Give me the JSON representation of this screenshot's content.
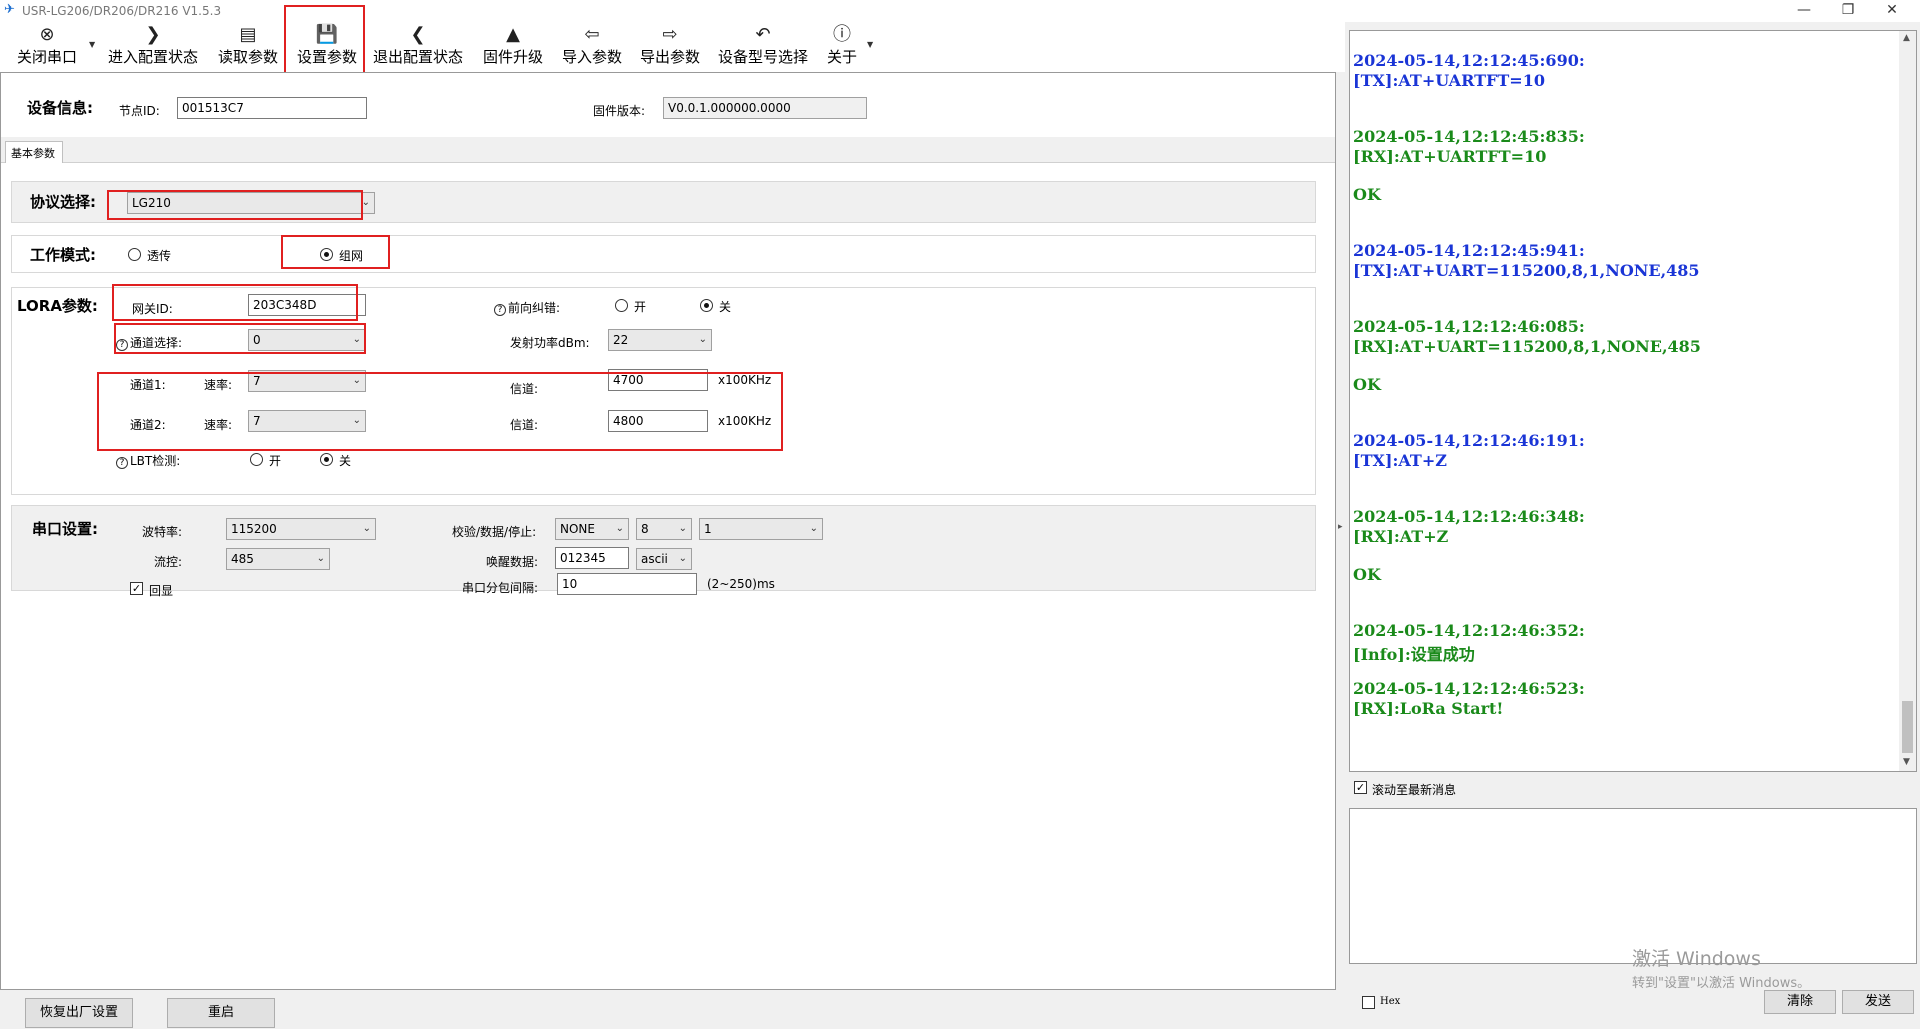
{
  "window": {
    "title": "USR-LG206/DR206/DR216 V1.5.3",
    "minimize": "—",
    "restore": "❐",
    "close": "✕"
  },
  "toolbar": {
    "items": [
      {
        "label": "关闭串口",
        "icon": "⊗"
      },
      {
        "label": "进入配置状态",
        "icon": "❯"
      },
      {
        "label": "读取参数",
        "icon": "▤"
      },
      {
        "label": "设置参数",
        "icon": "💾"
      },
      {
        "label": "退出配置状态",
        "icon": "❮"
      },
      {
        "label": "固件升级",
        "icon": "▲"
      },
      {
        "label": "导入参数",
        "icon": "⇦"
      },
      {
        "label": "导出参数",
        "icon": "⇨"
      },
      {
        "label": "设备型号选择",
        "icon": "↶"
      },
      {
        "label": "关于",
        "icon": "ⓘ"
      }
    ]
  },
  "device_info": {
    "header": "设备信息:",
    "node_id_label": "节点ID:",
    "node_id": "001513C7",
    "fw_label": "固件版本:",
    "fw_version": "V0.0.1.000000.0000"
  },
  "tabs": {
    "basic": "基本参数"
  },
  "protocol": {
    "header": "协议选择:",
    "value": "LG210"
  },
  "work_mode": {
    "header": "工作模式:",
    "opt1": "透传",
    "opt2": "组网",
    "selected": "组网"
  },
  "lora": {
    "header": "LORA参数:",
    "gateway_id_label": "网关ID:",
    "gateway_id": "203C348D",
    "fec_label": "前向纠错:",
    "fec_on": "开",
    "fec_off": "关",
    "channel_select_label": "通道选择:",
    "channel_select": "0",
    "tx_power_label": "发射功率dBm:",
    "tx_power": "22",
    "ch1_label": "通道1:",
    "ch2_label": "通道2:",
    "rate_label": "速率:",
    "ch1_rate": "7",
    "ch2_rate": "7",
    "channel_label": "信道:",
    "ch1_freq": "4700",
    "ch2_freq": "4800",
    "unit": "x100KHz",
    "lbt_label": "LBT检测:",
    "lbt_on": "开",
    "lbt_off": "关"
  },
  "serial": {
    "header": "串口设置:",
    "baud_label": "波特率:",
    "baud": "115200",
    "parity_label": "校验/数据/停止:",
    "parity": "NONE",
    "data_bits": "8",
    "stop_bits": "1",
    "flow_label": "流控:",
    "flow": "485",
    "wake_label": "唤醒数据:",
    "wake_data": "012345",
    "wake_fmt": "ascii",
    "echo_label": "回显",
    "pkt_label": "串口分包间隔:",
    "pkt_interval": "10",
    "pkt_range": "(2~250)ms"
  },
  "bottom": {
    "factory_reset": "恢复出厂设置",
    "restart": "重启"
  },
  "log": [
    {
      "text": "2024-05-14,12:12:45:690:",
      "kind": "tx"
    },
    {
      "text": "[TX]:AT+UARTFT=10",
      "kind": "tx"
    },
    {
      "text": "2024-05-14,12:12:45:835:",
      "kind": "rx"
    },
    {
      "text": "[RX]:AT+UARTFT=10",
      "kind": "rx"
    },
    {
      "text": "OK",
      "kind": "rx"
    },
    {
      "text": "2024-05-14,12:12:45:941:",
      "kind": "tx"
    },
    {
      "text": "[TX]:AT+UART=115200,8,1,NONE,485",
      "kind": "tx"
    },
    {
      "text": "2024-05-14,12:12:46:085:",
      "kind": "rx"
    },
    {
      "text": "[RX]:AT+UART=115200,8,1,NONE,485",
      "kind": "rx"
    },
    {
      "text": "OK",
      "kind": "rx"
    },
    {
      "text": "2024-05-14,12:12:46:191:",
      "kind": "tx"
    },
    {
      "text": "[TX]:AT+Z",
      "kind": "tx"
    },
    {
      "text": "2024-05-14,12:12:46:348:",
      "kind": "rx"
    },
    {
      "text": "[RX]:AT+Z",
      "kind": "rx"
    },
    {
      "text": "OK",
      "kind": "rx"
    },
    {
      "text": "2024-05-14,12:12:46:352:",
      "kind": "rx"
    },
    {
      "text": "[Info]:设置成功",
      "kind": "rx"
    },
    {
      "text": "2024-05-14,12:12:46:523:",
      "kind": "rx"
    },
    {
      "text": "[RX]:LoRa Start!",
      "kind": "rx"
    }
  ],
  "log_options": {
    "autoscroll": "滚动至最新消息"
  },
  "send": {
    "hex_label": "Hex",
    "clear": "清除",
    "send": "发送"
  },
  "watermark": {
    "line1": "激活 Windows",
    "line2": "转到\"设置\"以激活 Windows。"
  },
  "colors": {
    "tx": "#1a35d6",
    "rx": "#1a8a1a",
    "highlight": "#e02020"
  }
}
